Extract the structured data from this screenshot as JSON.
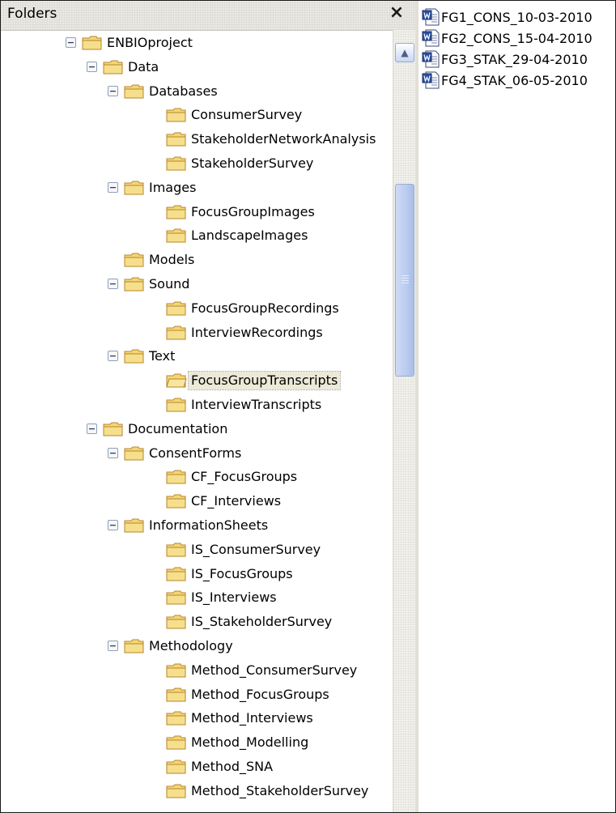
{
  "folders_pane": {
    "title": "Folders",
    "close_glyph": "×",
    "scroll_up_glyph": "▲"
  },
  "tree": [
    {
      "label": "ENBIOproject",
      "level": 0,
      "expanded": true
    },
    {
      "label": "Data",
      "level": 1,
      "expanded": true
    },
    {
      "label": "Databases",
      "level": 2,
      "expanded": true
    },
    {
      "label": "ConsumerSurvey",
      "level": 3
    },
    {
      "label": "StakeholderNetworkAnalysis",
      "level": 3
    },
    {
      "label": "StakeholderSurvey",
      "level": 3
    },
    {
      "label": "Images",
      "level": 2,
      "expanded": true
    },
    {
      "label": "FocusGroupImages",
      "level": 3
    },
    {
      "label": "LandscapeImages",
      "level": 3
    },
    {
      "label": "Models",
      "level": 2
    },
    {
      "label": "Sound",
      "level": 2,
      "expanded": true
    },
    {
      "label": "FocusGroupRecordings",
      "level": 3
    },
    {
      "label": "InterviewRecordings",
      "level": 3
    },
    {
      "label": "Text",
      "level": 2,
      "expanded": true
    },
    {
      "label": "FocusGroupTranscripts",
      "level": 3,
      "selected": true,
      "open": true
    },
    {
      "label": "InterviewTranscripts",
      "level": 3
    },
    {
      "label": "Documentation",
      "level": 1,
      "expanded": true
    },
    {
      "label": "ConsentForms",
      "level": 2,
      "expanded": true
    },
    {
      "label": "CF_FocusGroups",
      "level": 3
    },
    {
      "label": "CF_Interviews",
      "level": 3
    },
    {
      "label": "InformationSheets",
      "level": 2,
      "expanded": true
    },
    {
      "label": "IS_ConsumerSurvey",
      "level": 3
    },
    {
      "label": "IS_FocusGroups",
      "level": 3
    },
    {
      "label": "IS_Interviews",
      "level": 3
    },
    {
      "label": "IS_StakeholderSurvey",
      "level": 3
    },
    {
      "label": "Methodology",
      "level": 2,
      "expanded": true
    },
    {
      "label": "Method_ConsumerSurvey",
      "level": 3
    },
    {
      "label": "Method_FocusGroups",
      "level": 3
    },
    {
      "label": "Method_Interviews",
      "level": 3
    },
    {
      "label": "Method_Modelling",
      "level": 3
    },
    {
      "label": "Method_SNA",
      "level": 3
    },
    {
      "label": "Method_StakeholderSurvey",
      "level": 3
    }
  ],
  "files": [
    {
      "name": "FG1_CONS_10-03-2010",
      "icon": "word-document-icon"
    },
    {
      "name": "FG2_CONS_15-04-2010",
      "icon": "word-document-icon"
    },
    {
      "name": "FG3_STAK_29-04-2010",
      "icon": "word-document-icon"
    },
    {
      "name": "FG4_STAK_06-05-2010",
      "icon": "word-document-icon"
    }
  ],
  "colors": {
    "folder_fill": "#f3d777",
    "folder_edge": "#b8862b",
    "selected_bg": "#ece9d8",
    "scroll_thumb": "#b9cbf0"
  }
}
